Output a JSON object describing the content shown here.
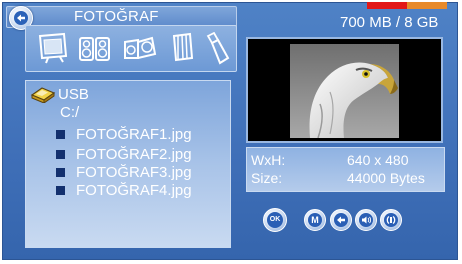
{
  "header": {
    "title": "FOTOĞRAF",
    "storage_text": "700 MB / 8 GB",
    "storage_used_fraction": 0.5
  },
  "file_types": [
    "photo-frame-icon",
    "speakers-icon",
    "projector-icon",
    "document-icon",
    "usb-stick-icon"
  ],
  "browser": {
    "device": "USB",
    "path": "C:/",
    "files": [
      "FOTOĞRAF1.jpg",
      "FOTOĞRAF2.jpg",
      "FOTOĞRAF3.jpg",
      "FOTOĞRAF4.jpg"
    ]
  },
  "info": {
    "wxh_label": "WxH:",
    "wxh_value": "640 x 480",
    "size_label": "Size:",
    "size_value": "44000 Bytes"
  },
  "controls": {
    "ok_label": "OK",
    "menu_label": "M"
  },
  "colors": {
    "background": "#3f6fb8",
    "storage_used": "#e21818",
    "storage_free": "#e88a2b",
    "bullet": "#13306e"
  }
}
